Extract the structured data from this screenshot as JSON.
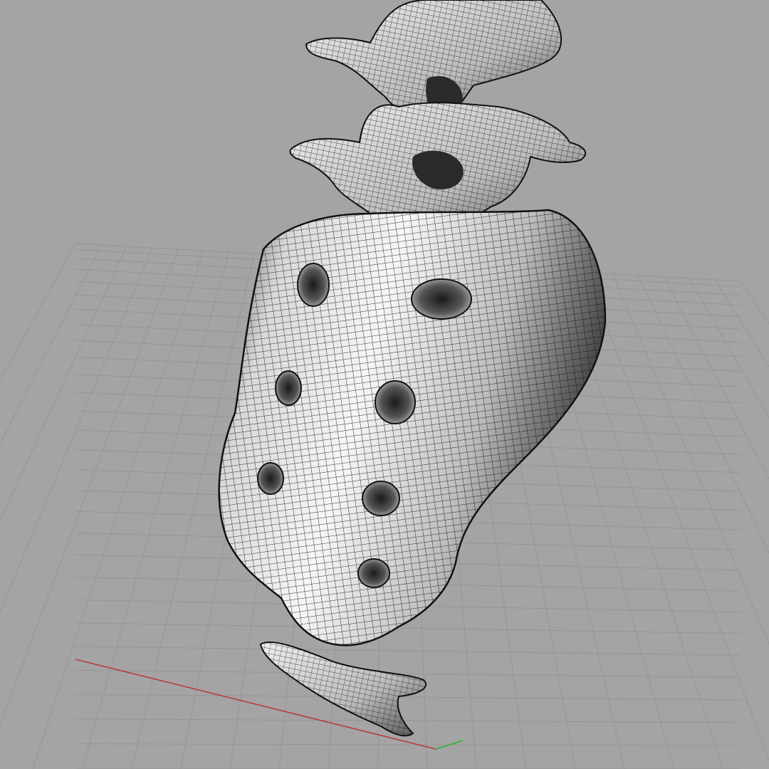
{
  "viewport": {
    "view": "perspective",
    "display_mode": "wireframe-shaded",
    "background_color": "#a4a4a4",
    "grid_visible": true,
    "grid_color": "#959595",
    "x_axis_color": "#b83a3a",
    "y_axis_color": "#2fb32f"
  },
  "model": {
    "parts": [
      "lumbar-vertebra-upper",
      "lumbar-vertebra-lower",
      "sacrum",
      "coccyx"
    ],
    "surface_color": "#efefef",
    "wire_color": "#111111"
  }
}
